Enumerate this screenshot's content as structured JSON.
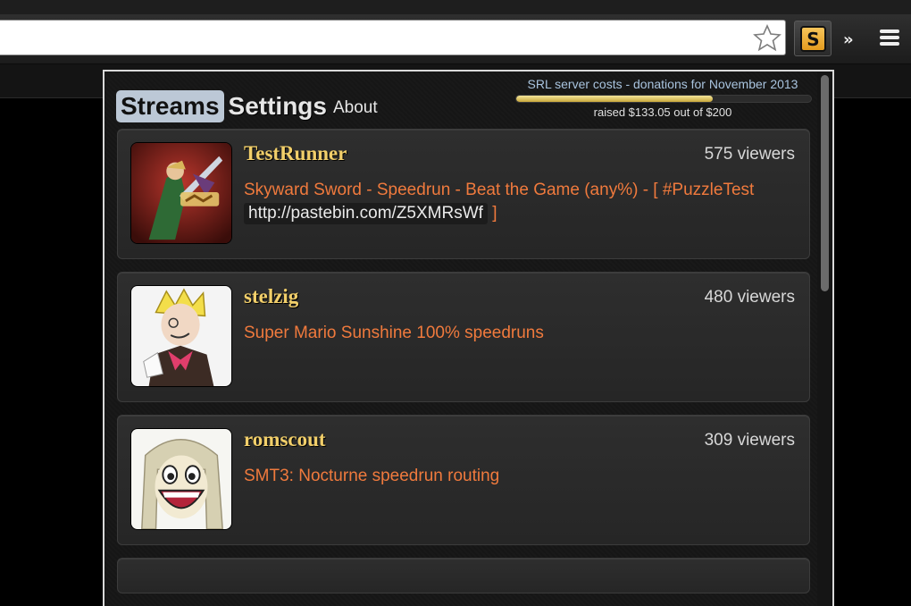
{
  "browser": {
    "star_icon": "star-icon",
    "extension_icon": {
      "name": "srl-extension-icon",
      "glyph": "S"
    },
    "overflow_glyph": "»",
    "menu_icon": "menu-icon"
  },
  "popup": {
    "tabs": {
      "streams": "Streams",
      "settings": "Settings",
      "about": "About"
    },
    "donation": {
      "title": "SRL server costs - donations for November 2013",
      "raised_text": "raised $133.05 out of $200",
      "raised": 133.05,
      "goal": 200,
      "bar_color": "#d8c46a"
    },
    "streams": [
      {
        "name": "TestRunner",
        "viewers": "575 viewers",
        "status_text": "Skyward Sword - Speedrun - Beat the Game (any%) - [ #PuzzleTest",
        "status_link": "http://pastebin.com/Z5XMRsWf",
        "status_after": "]",
        "avatar": "zelda-cover-art"
      },
      {
        "name": "stelzig",
        "viewers": "480 viewers",
        "status_text": "Super Mario Sunshine 100% speedruns",
        "avatar": "anime-character-art"
      },
      {
        "name": "romscout",
        "viewers": "309 viewers",
        "status_text": "SMT3: Nocturne speedrun routing",
        "avatar": "smiling-face-art"
      }
    ],
    "colors": {
      "stream_name": "#f2cf6a",
      "status": "#f07a3d",
      "active_tab": "#bcc8d6"
    }
  }
}
